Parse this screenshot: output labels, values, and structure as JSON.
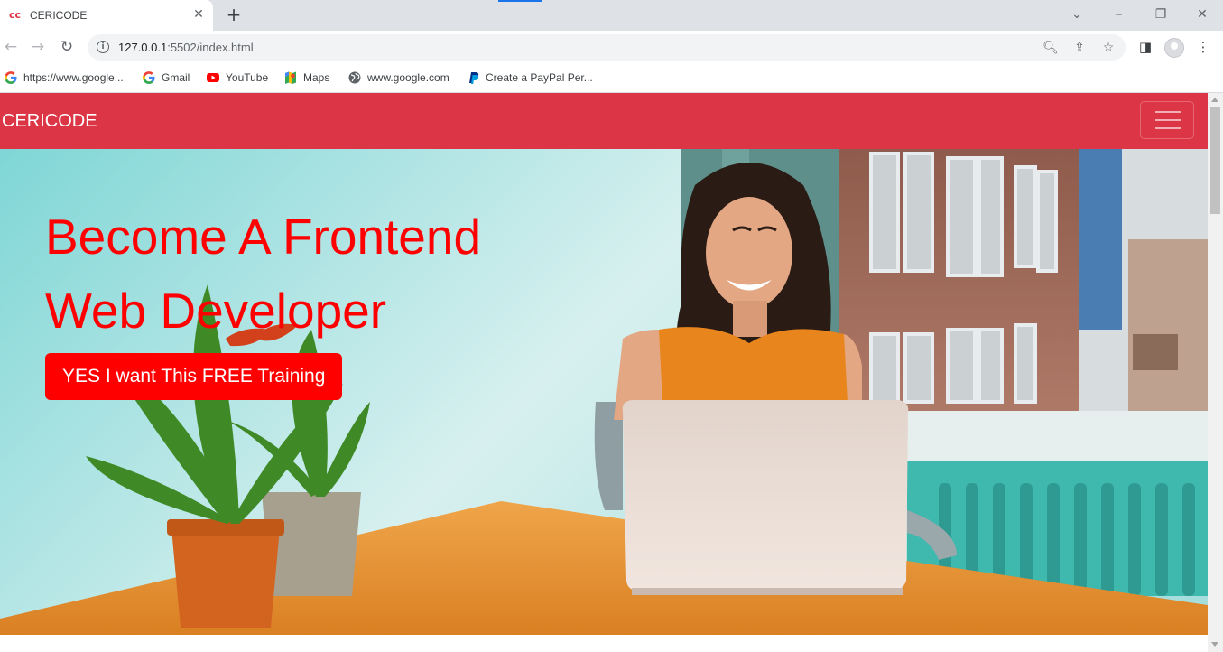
{
  "browser": {
    "tab_title": "CERICODE",
    "tab_favicon": "cc",
    "url_host": "127.0.0.1",
    "url_rest": ":5502/index.html",
    "bookmarks": [
      {
        "label": "https://www.google...",
        "icon": "google-icon"
      },
      {
        "label": "Gmail",
        "icon": "google-icon"
      },
      {
        "label": "YouTube",
        "icon": "youtube-icon"
      },
      {
        "label": "Maps",
        "icon": "maps-icon"
      },
      {
        "label": "www.google.com",
        "icon": "globe-icon"
      },
      {
        "label": "Create a PayPal Per...",
        "icon": "paypal-icon"
      }
    ]
  },
  "site": {
    "brand": "CERICODE",
    "accent_color": "#dc3545",
    "hero": {
      "headline_line1": "Become A Frontend",
      "headline_line2": "Web Developer",
      "cta_label": "YES I want This FREE Training",
      "cta_color": "#ff0000",
      "image_icon": "hero-photo-woman-laptop"
    }
  }
}
